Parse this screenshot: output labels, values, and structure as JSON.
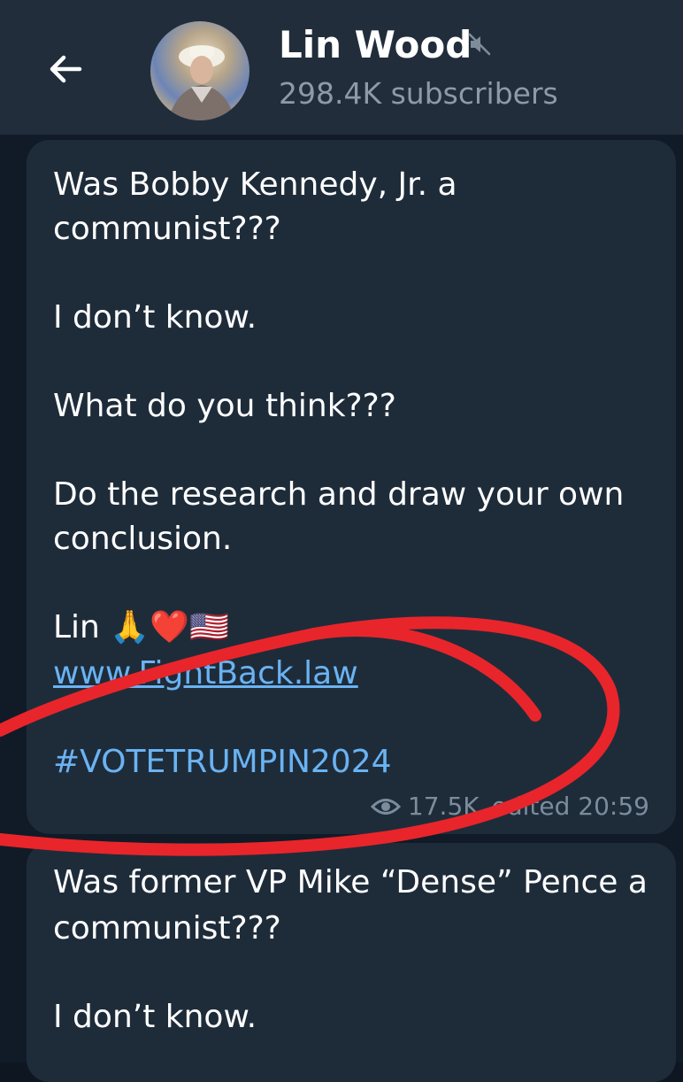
{
  "header": {
    "title": "Lin Wood",
    "subtitle": "298.4K subscribers"
  },
  "messages": [
    {
      "lines": [
        "Was Bobby Kennedy, Jr. a",
        "communist???",
        "I don’t know.",
        "What do you think???",
        "Do the research and draw your own",
        "conclusion.",
        "Lin 🙏❤️🇺🇸"
      ],
      "link": "www.FightBack.law",
      "hashtag": "#VOTETRUMPIN2024",
      "views": "17.5K",
      "edited_time": "edited 20:59"
    },
    {
      "lines": [
        "Was former VP Mike “Dense” Pence a",
        "communist???",
        "I don’t know."
      ]
    }
  ],
  "colors": {
    "header_bg": "#212d3b",
    "bubble_bg": "#1e2c3a",
    "link": "#6ab3f3",
    "annotation": "#e8252b"
  },
  "icons": {
    "back": "back-arrow-icon",
    "mute": "mute-icon",
    "views": "eye-icon"
  }
}
